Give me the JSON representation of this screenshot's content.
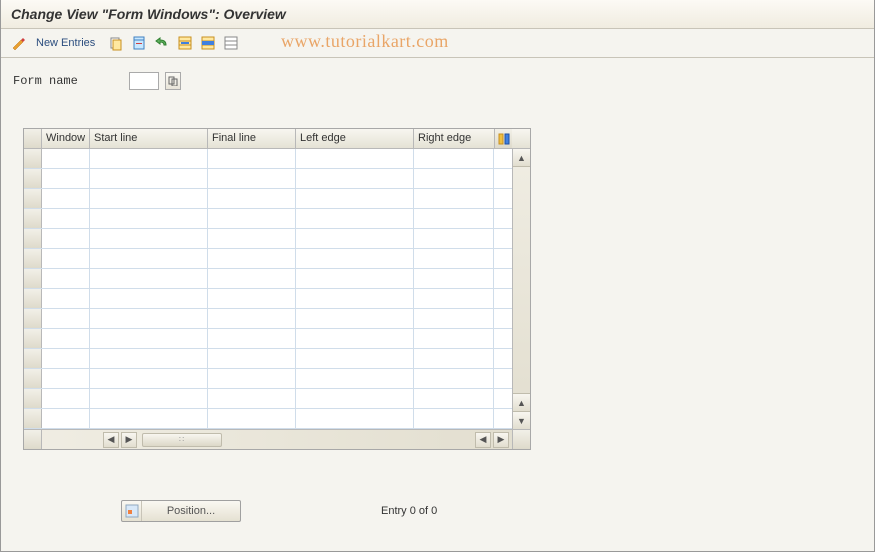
{
  "title": "Change View \"Form Windows\": Overview",
  "toolbar": {
    "new_entries_label": "New Entries"
  },
  "watermark": "www.tutorialkart.com",
  "form": {
    "form_name_label": "Form name",
    "form_name_value": ""
  },
  "table": {
    "columns": {
      "window": "Window",
      "start_line": "Start line",
      "final_line": "Final line",
      "left_edge": "Left edge",
      "right_edge": "Right edge"
    }
  },
  "footer": {
    "position_label": "Position...",
    "entry_text": "Entry 0 of 0"
  }
}
